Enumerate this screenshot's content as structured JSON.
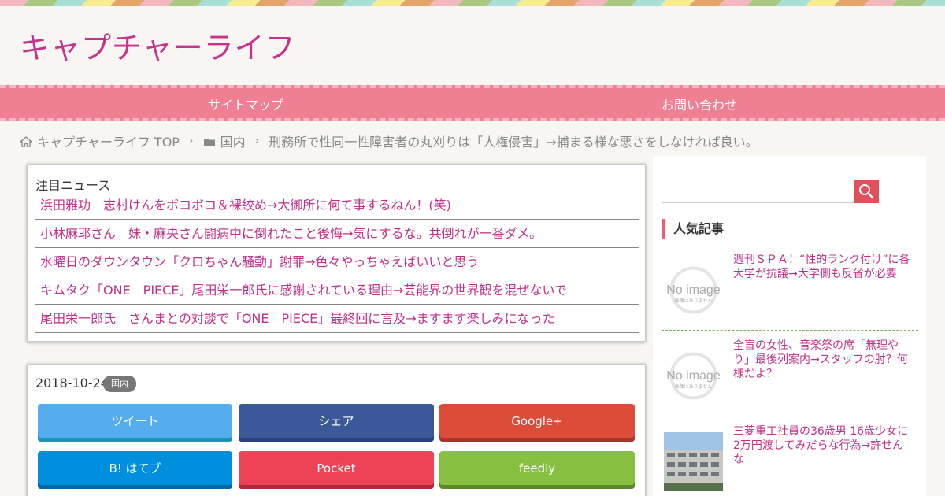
{
  "site": {
    "title": "キャプチャーライフ"
  },
  "nav": {
    "items": [
      "サイトマップ",
      "お問い合わせ"
    ]
  },
  "breadcrumb": {
    "home": "キャプチャーライフ TOP",
    "category": "国内",
    "current": "刑務所で性同一性障害者の丸刈りは「人権侵害」→捕まる様な悪さをしなければ良い。"
  },
  "news": {
    "heading": "注目ニュース",
    "items": [
      "浜田雅功　志村けんをボコボコ＆裸絞め→大御所に何て事するねん！(笑)",
      "小林麻耶さん　妹・麻央さん闘病中に倒れたこと後悔→気にするな。共倒れが一番ダメ。",
      "水曜日のダウンタウン「クロちゃん騒動」謝罪→色々やっちゃえばいいと思う",
      "キムタク「ONE　PIECE」尾田栄一郎氏に感謝されている理由→芸能界の世界観を混ぜないで",
      "尾田栄一郎氏　さんまとの対談で「ONE　PIECE」最終回に言及→ますます楽しみになった"
    ]
  },
  "post": {
    "date": "2018-10-24",
    "category": "国内",
    "share": {
      "tweet": "ツイート",
      "facebook": "シェア",
      "google": "Google+",
      "hatena": "B! はてブ",
      "pocket": "Pocket",
      "feedly": "feedly"
    }
  },
  "sidebar": {
    "search": {
      "placeholder": ""
    },
    "popular_heading": "人気記事",
    "popular": [
      {
        "title": "週刊ＳＰＡ！“性的ランク付け”に各大学が抗議→大学側も反省が必要",
        "thumb_text": "No image",
        "thumb_sub": "画像はありません"
      },
      {
        "title": "全盲の女性、音楽祭の席「無理やり」最後列案内→スタッフの肘？何様だよ？",
        "thumb_text": "No image",
        "thumb_sub": "画像はありません"
      },
      {
        "title": "三菱重工社員の36歳男 16歳少女に2万円渡してみだらな行為→許せんな"
      }
    ]
  },
  "colors": {
    "brand": "#c8328c",
    "nav": "#ef7f92",
    "link": "#c0308a",
    "tweet": "#55acee",
    "facebook": "#3b5998",
    "google": "#dd4b39",
    "hatena": "#008fde",
    "pocket": "#ee4256",
    "feedly": "#87c040"
  }
}
